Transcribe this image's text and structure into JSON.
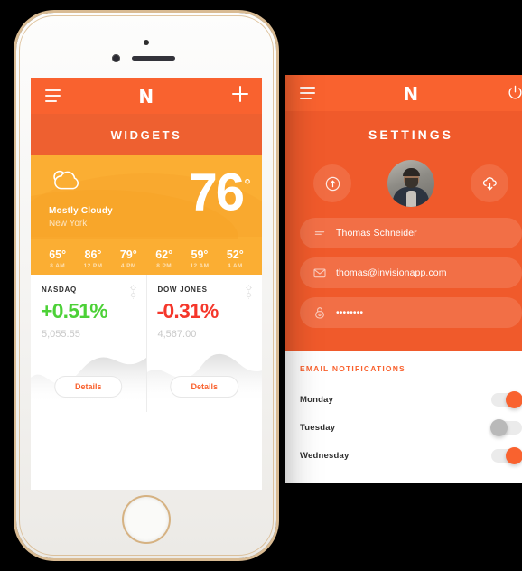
{
  "app": {
    "brand": "N"
  },
  "left_phone": {
    "nav": {
      "menu_icon": "hamburger-icon",
      "brand": "N",
      "add_icon": "plus-icon"
    },
    "title": "WIDGETS",
    "weather": {
      "condition": "Mostly Cloudy",
      "city": "New York",
      "temperature": "76",
      "degree": "°",
      "icon": "cloud-icon",
      "forecast": [
        {
          "temp": "65°",
          "hour": "8 AM"
        },
        {
          "temp": "86°",
          "hour": "12 PM"
        },
        {
          "temp": "79°",
          "hour": "4 PM"
        },
        {
          "temp": "62°",
          "hour": "8 PM"
        },
        {
          "temp": "59°",
          "hour": "12 AM"
        },
        {
          "temp": "52°",
          "hour": "4 AM"
        }
      ]
    },
    "stocks": [
      {
        "label": "NASDAQ",
        "change": "+0.51%",
        "value": "5,055.55",
        "color": "#4CD137",
        "details": "Details"
      },
      {
        "label": "DOW JONES",
        "change": "-0.31%",
        "value": "4,567.00",
        "color": "#F5372B",
        "details": "Details"
      }
    ]
  },
  "right_phone": {
    "nav": {
      "menu_icon": "hamburger-icon",
      "brand": "N",
      "power_icon": "power-icon"
    },
    "title": "SETTINGS",
    "upload_icon": "upload-cloud-icon",
    "download_icon": "download-cloud-icon",
    "avatar": "user-avatar",
    "fields": [
      {
        "icon": "id-card-icon",
        "value": "Thomas Schneider",
        "name": "name-field"
      },
      {
        "icon": "envelope-icon",
        "value": "thomas@invisionapp.com",
        "name": "email-field"
      },
      {
        "icon": "lock-icon",
        "value": "••••••••",
        "name": "password-field"
      }
    ],
    "notifications": {
      "heading": "EMAIL NOTIFICATIONS",
      "rows": [
        {
          "label": "Monday",
          "state": "on"
        },
        {
          "label": "Tuesday",
          "state": "off"
        },
        {
          "label": "Wednesday",
          "state": "on"
        }
      ]
    }
  },
  "colors": {
    "orange": "#F9622F",
    "orange_dark": "#EE6030",
    "amber": "#FBAE33",
    "up": "#4CD137",
    "down": "#F5372B"
  }
}
